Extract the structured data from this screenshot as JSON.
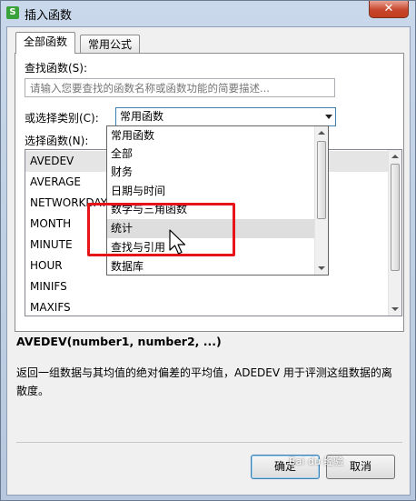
{
  "window": {
    "title": "插入函数",
    "app_icon": "S",
    "close_label": "✕"
  },
  "tabs": [
    {
      "label": "全部函数",
      "active": true
    },
    {
      "label": "常用公式",
      "active": false
    }
  ],
  "search": {
    "label": "查找函数(S):",
    "placeholder": "请输入您要查找的函数名称或函数功能的简要描述..."
  },
  "category": {
    "label": "或选择类别(C):",
    "selected": "常用函数",
    "options": [
      "常用函数",
      "全部",
      "财务",
      "日期与时间",
      "数学与三角函数",
      "统计",
      "查找与引用",
      "数据库"
    ],
    "highlighted": "统计"
  },
  "functions": {
    "label": "选择函数(N):",
    "items": [
      "AVEDEV",
      "AVERAGE",
      "NETWORKDAYS",
      "MONTH",
      "MINUTE",
      "HOUR",
      "MINIFS",
      "MAXIFS"
    ],
    "selected": "AVEDEV"
  },
  "detail": {
    "syntax": "AVEDEV(number1, number2, ...)",
    "description": "返回一组数据与其均值的绝对偏差的平均值，ADEDEV 用于评测这组数据的离散度。"
  },
  "buttons": {
    "ok": "确定",
    "cancel": "取消"
  },
  "watermark": "Bai du 经验",
  "colors": {
    "highlight_frame": "#e6151a",
    "selection": "#e5e5e5"
  },
  "icons": {
    "cursor": "arrow-cursor-icon",
    "dropdown": "chevron-down-icon"
  }
}
